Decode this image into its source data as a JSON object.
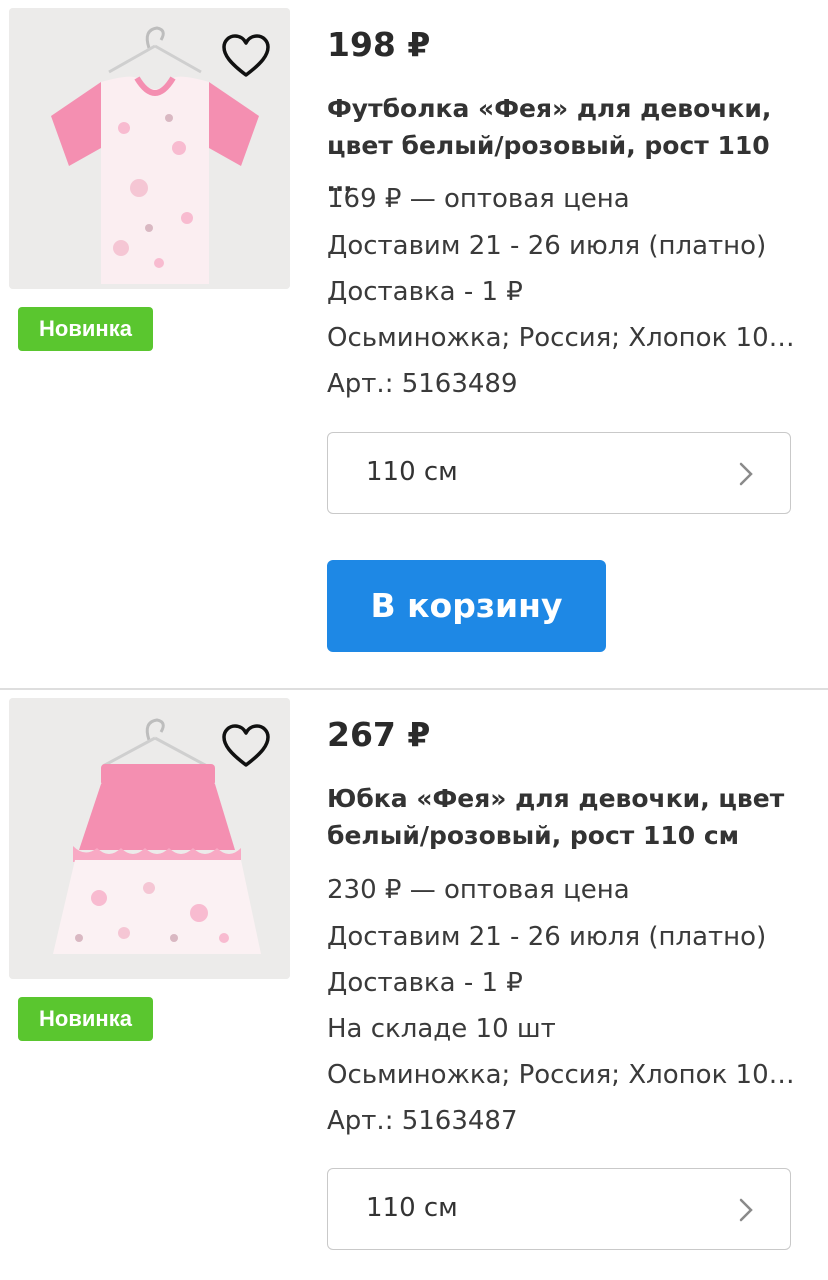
{
  "products": [
    {
      "price": "198 ₽",
      "title": "Футболка «Фея» для девочки, цвет белый/розовый, рост 110 …",
      "wholesale": "169 ₽ — оптовая цена",
      "delivery_date": "Доставим 21 - 26 июля (платно)",
      "delivery_cost": "Доставка - 1 ₽",
      "attributes": "Осьминожка; Россия; Хлопок 10…",
      "article": "Арт.: 5163489",
      "badge": "Новинка",
      "size": "110 см",
      "cart_label": "В корзину",
      "image_icon": "tshirt-image",
      "favorite_icon": "heart-outline-icon"
    },
    {
      "price": "267 ₽",
      "title": "Юбка «Фея» для девочки, цвет белый/розовый, рост 110 см",
      "wholesale": "230 ₽ — оптовая цена",
      "delivery_date": "Доставим 21 - 26 июля (платно)",
      "delivery_cost": "Доставка - 1 ₽",
      "stock": "На складе 10 шт",
      "attributes": "Осьминожка; Россия; Хлопок 10…",
      "article": "Арт.: 5163487",
      "badge": "Новинка",
      "size": "110 см",
      "image_icon": "skirt-image",
      "favorite_icon": "heart-outline-icon"
    }
  ],
  "colors": {
    "accent_blue": "#1e88e5",
    "badge_green": "#5ac62f",
    "divider": "#dedede",
    "garment_pink": "#f48fb1"
  }
}
